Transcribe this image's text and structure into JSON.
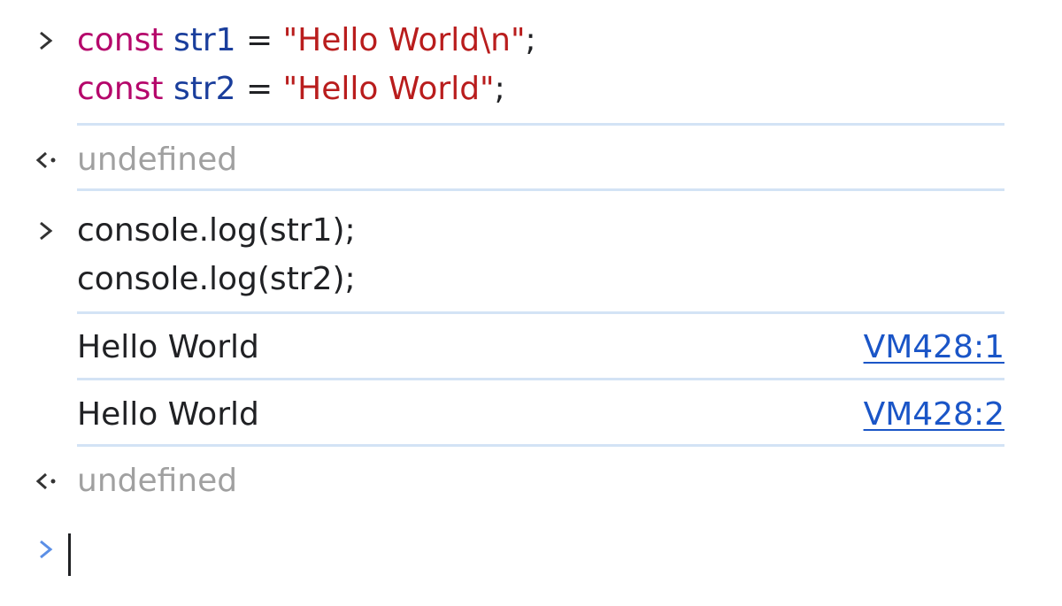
{
  "entries": [
    {
      "type": "input",
      "lines": [
        {
          "kw": "const",
          "var": "str1",
          "op": "=",
          "str": "\"Hello World\\n\"",
          "end": ";"
        },
        {
          "kw": "const",
          "var": "str2",
          "op": "=",
          "str": "\"Hello World\"",
          "end": ";"
        }
      ]
    },
    {
      "type": "result",
      "text": "undefined"
    },
    {
      "type": "input",
      "lines": [
        "console.log(str1);",
        "console.log(str2);"
      ]
    },
    {
      "type": "log",
      "text": "Hello World",
      "source": "VM428:1"
    },
    {
      "type": "log",
      "text": "Hello World",
      "source": "VM428:2"
    },
    {
      "type": "result",
      "text": "undefined"
    }
  ],
  "prompt": {
    "current_value": ""
  },
  "icons": {
    "input_prompt": "chevron-right-icon",
    "result_prompt": "return-arrow-icon",
    "active_prompt": "chevron-right-icon"
  },
  "colors": {
    "keyword": "#b5076b",
    "variable": "#1a3e9c",
    "string": "#b91d1d",
    "link": "#1a55c7",
    "separator": "#d3e3f5",
    "active_prompt": "#5b8fe6",
    "result_text": "#a0a0a0"
  }
}
